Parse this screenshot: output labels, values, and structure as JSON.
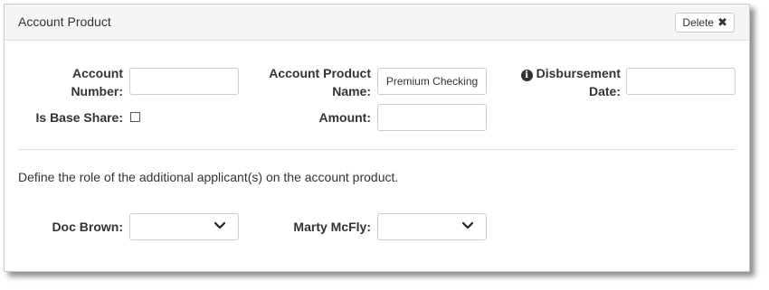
{
  "panel": {
    "title": "Account Product",
    "delete_label": "Delete",
    "delete_icon": "close-icon"
  },
  "fields": {
    "account_number": {
      "label_line1": "Account",
      "label_line2": "Number:",
      "value": ""
    },
    "account_product_name": {
      "label_line1": "Account Product",
      "label_line2": "Name:",
      "value": "Premium Checking"
    },
    "disbursement_date": {
      "label_line1": "Disbursement",
      "label_line2": "Date:",
      "value": "",
      "icon": "info-icon"
    },
    "is_base_share": {
      "label": "Is Base Share:",
      "checked": false
    },
    "amount": {
      "label": "Amount:",
      "value": ""
    }
  },
  "applicants": {
    "instructions": "Define the role of the additional applicant(s) on the account product.",
    "items": [
      {
        "label": "Doc Brown:",
        "selected": ""
      },
      {
        "label": "Marty McFly:",
        "selected": ""
      }
    ]
  }
}
